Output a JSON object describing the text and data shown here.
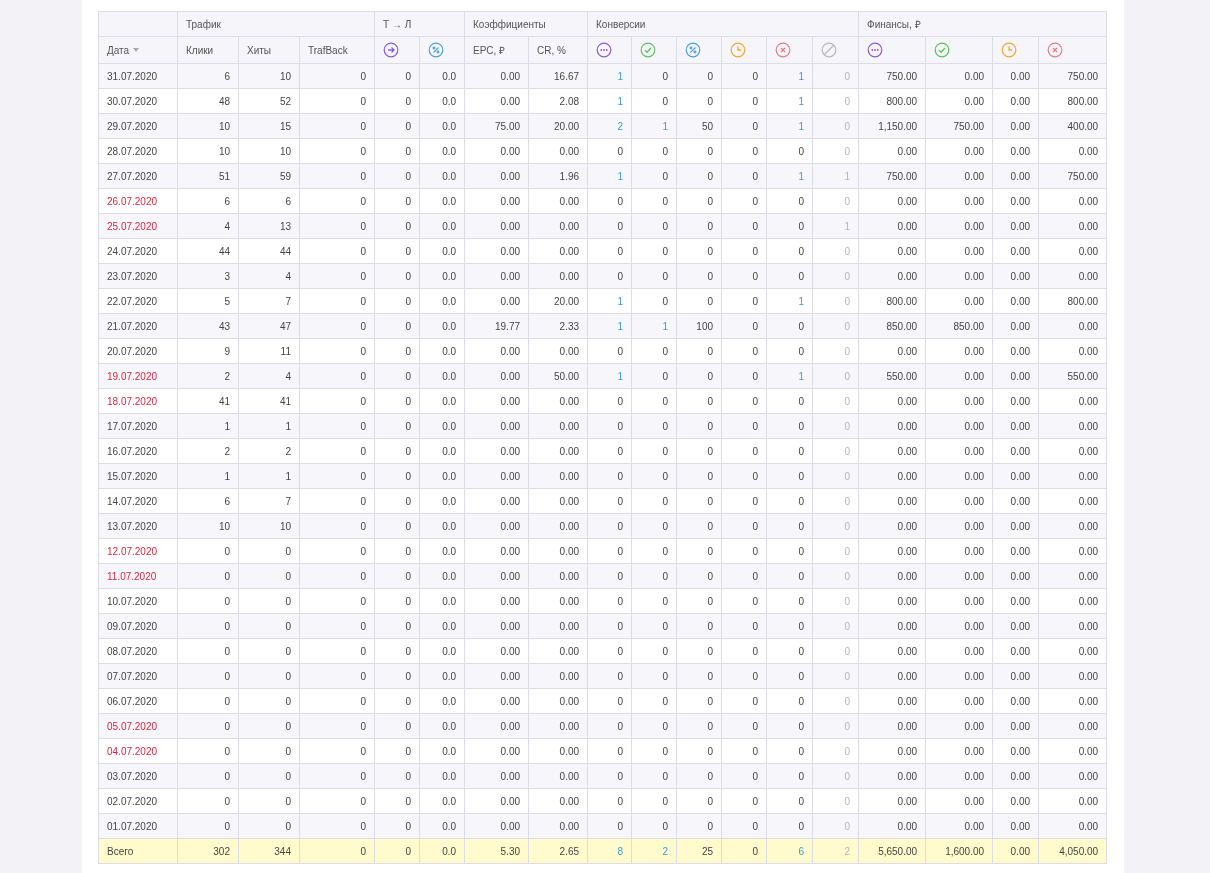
{
  "groups": [
    {
      "label": "Трафик"
    },
    {
      "label": "Т → Л"
    },
    {
      "label": "Коэффициенты"
    },
    {
      "label": "Конверсии"
    },
    {
      "label": "Финансы, ₽"
    }
  ],
  "columns": [
    {
      "kind": "text",
      "label": "Дата",
      "sorted": true
    },
    {
      "kind": "text",
      "label": "Клики"
    },
    {
      "kind": "text",
      "label": "Хиты"
    },
    {
      "kind": "text",
      "label": "TrafBack"
    },
    {
      "kind": "icon"
    },
    {
      "kind": "icon"
    },
    {
      "kind": "text",
      "label": "EPC, ₽"
    },
    {
      "kind": "text",
      "label": "CR, %"
    },
    {
      "kind": "icon"
    },
    {
      "kind": "icon"
    },
    {
      "kind": "icon"
    },
    {
      "kind": "icon"
    },
    {
      "kind": "icon"
    },
    {
      "kind": "icon"
    },
    {
      "kind": "icon"
    },
    {
      "kind": "icon"
    },
    {
      "kind": "icon"
    },
    {
      "kind": "icon"
    }
  ],
  "rows": [
    {
      "date": "31.07.2020",
      "weekend": false,
      "cells": [
        "6",
        "10",
        "0",
        "0",
        "0.0",
        "0.00",
        "16.67",
        {
          "kind": "link",
          "value": "1"
        },
        "0",
        "0",
        "0",
        {
          "kind": "link",
          "value": "1"
        },
        "0",
        "750.00",
        "0.00",
        "0.00",
        "750.00"
      ]
    },
    {
      "date": "30.07.2020",
      "weekend": false,
      "cells": [
        "48",
        "52",
        "0",
        "0",
        "0.0",
        "0.00",
        "2.08",
        {
          "kind": "link",
          "value": "1"
        },
        "0",
        "0",
        "0",
        {
          "kind": "link",
          "value": "1"
        },
        "0",
        "800.00",
        "0.00",
        "0.00",
        "800.00"
      ]
    },
    {
      "date": "29.07.2020",
      "weekend": false,
      "cells": [
        "10",
        "15",
        "0",
        "0",
        "0.0",
        "75.00",
        "20.00",
        {
          "kind": "link",
          "value": "2"
        },
        {
          "kind": "link",
          "value": "1"
        },
        "50",
        "0",
        {
          "kind": "link",
          "value": "1"
        },
        "0",
        "1,150.00",
        "750.00",
        "0.00",
        "400.00"
      ]
    },
    {
      "date": "28.07.2020",
      "weekend": false,
      "cells": [
        "10",
        "10",
        "0",
        "0",
        "0.0",
        "0.00",
        "0.00",
        "0",
        "0",
        "0",
        "0",
        "0",
        "0",
        "0.00",
        "0.00",
        "0.00",
        "0.00"
      ]
    },
    {
      "date": "27.07.2020",
      "weekend": false,
      "cells": [
        "51",
        "59",
        "0",
        "0",
        "0.0",
        "0.00",
        "1.96",
        {
          "kind": "link",
          "value": "1"
        },
        "0",
        "0",
        "0",
        {
          "kind": "link",
          "value": "1"
        },
        "1",
        "750.00",
        "0.00",
        "0.00",
        "750.00"
      ]
    },
    {
      "date": "26.07.2020",
      "weekend": true,
      "cells": [
        "6",
        "6",
        "0",
        "0",
        "0.0",
        "0.00",
        "0.00",
        "0",
        "0",
        "0",
        "0",
        "0",
        "0",
        "0.00",
        "0.00",
        "0.00",
        "0.00"
      ]
    },
    {
      "date": "25.07.2020",
      "weekend": true,
      "cells": [
        "4",
        "13",
        "0",
        "0",
        "0.0",
        "0.00",
        "0.00",
        "0",
        "0",
        "0",
        "0",
        "0",
        "1",
        "0.00",
        "0.00",
        "0.00",
        "0.00"
      ]
    },
    {
      "date": "24.07.2020",
      "weekend": false,
      "cells": [
        "44",
        "44",
        "0",
        "0",
        "0.0",
        "0.00",
        "0.00",
        "0",
        "0",
        "0",
        "0",
        "0",
        "0",
        "0.00",
        "0.00",
        "0.00",
        "0.00"
      ]
    },
    {
      "date": "23.07.2020",
      "weekend": false,
      "cells": [
        "3",
        "4",
        "0",
        "0",
        "0.0",
        "0.00",
        "0.00",
        "0",
        "0",
        "0",
        "0",
        "0",
        "0",
        "0.00",
        "0.00",
        "0.00",
        "0.00"
      ]
    },
    {
      "date": "22.07.2020",
      "weekend": false,
      "cells": [
        "5",
        "7",
        "0",
        "0",
        "0.0",
        "0.00",
        "20.00",
        {
          "kind": "link",
          "value": "1"
        },
        "0",
        "0",
        "0",
        {
          "kind": "link",
          "value": "1"
        },
        "0",
        "800.00",
        "0.00",
        "0.00",
        "800.00"
      ]
    },
    {
      "date": "21.07.2020",
      "weekend": false,
      "cells": [
        "43",
        "47",
        "0",
        "0",
        "0.0",
        "19.77",
        "2.33",
        {
          "kind": "link",
          "value": "1"
        },
        {
          "kind": "link",
          "value": "1"
        },
        "100",
        "0",
        "0",
        "0",
        "850.00",
        "850.00",
        "0.00",
        "0.00"
      ]
    },
    {
      "date": "20.07.2020",
      "weekend": false,
      "cells": [
        "9",
        "11",
        "0",
        "0",
        "0.0",
        "0.00",
        "0.00",
        "0",
        "0",
        "0",
        "0",
        "0",
        "0",
        "0.00",
        "0.00",
        "0.00",
        "0.00"
      ]
    },
    {
      "date": "19.07.2020",
      "weekend": true,
      "cells": [
        "2",
        "4",
        "0",
        "0",
        "0.0",
        "0.00",
        "50.00",
        {
          "kind": "link",
          "value": "1"
        },
        "0",
        "0",
        "0",
        {
          "kind": "link",
          "value": "1"
        },
        "0",
        "550.00",
        "0.00",
        "0.00",
        "550.00"
      ]
    },
    {
      "date": "18.07.2020",
      "weekend": true,
      "cells": [
        "41",
        "41",
        "0",
        "0",
        "0.0",
        "0.00",
        "0.00",
        "0",
        "0",
        "0",
        "0",
        "0",
        "0",
        "0.00",
        "0.00",
        "0.00",
        "0.00"
      ]
    },
    {
      "date": "17.07.2020",
      "weekend": false,
      "cells": [
        "1",
        "1",
        "0",
        "0",
        "0.0",
        "0.00",
        "0.00",
        "0",
        "0",
        "0",
        "0",
        "0",
        "0",
        "0.00",
        "0.00",
        "0.00",
        "0.00"
      ]
    },
    {
      "date": "16.07.2020",
      "weekend": false,
      "cells": [
        "2",
        "2",
        "0",
        "0",
        "0.0",
        "0.00",
        "0.00",
        "0",
        "0",
        "0",
        "0",
        "0",
        "0",
        "0.00",
        "0.00",
        "0.00",
        "0.00"
      ]
    },
    {
      "date": "15.07.2020",
      "weekend": false,
      "cells": [
        "1",
        "1",
        "0",
        "0",
        "0.0",
        "0.00",
        "0.00",
        "0",
        "0",
        "0",
        "0",
        "0",
        "0",
        "0.00",
        "0.00",
        "0.00",
        "0.00"
      ]
    },
    {
      "date": "14.07.2020",
      "weekend": false,
      "cells": [
        "6",
        "7",
        "0",
        "0",
        "0.0",
        "0.00",
        "0.00",
        "0",
        "0",
        "0",
        "0",
        "0",
        "0",
        "0.00",
        "0.00",
        "0.00",
        "0.00"
      ]
    },
    {
      "date": "13.07.2020",
      "weekend": false,
      "cells": [
        "10",
        "10",
        "0",
        "0",
        "0.0",
        "0.00",
        "0.00",
        "0",
        "0",
        "0",
        "0",
        "0",
        "0",
        "0.00",
        "0.00",
        "0.00",
        "0.00"
      ]
    },
    {
      "date": "12.07.2020",
      "weekend": true,
      "cells": [
        "0",
        "0",
        "0",
        "0",
        "0.0",
        "0.00",
        "0.00",
        "0",
        "0",
        "0",
        "0",
        "0",
        "0",
        "0.00",
        "0.00",
        "0.00",
        "0.00"
      ]
    },
    {
      "date": "11.07.2020",
      "weekend": true,
      "cells": [
        "0",
        "0",
        "0",
        "0",
        "0.0",
        "0.00",
        "0.00",
        "0",
        "0",
        "0",
        "0",
        "0",
        "0",
        "0.00",
        "0.00",
        "0.00",
        "0.00"
      ]
    },
    {
      "date": "10.07.2020",
      "weekend": false,
      "cells": [
        "0",
        "0",
        "0",
        "0",
        "0.0",
        "0.00",
        "0.00",
        "0",
        "0",
        "0",
        "0",
        "0",
        "0",
        "0.00",
        "0.00",
        "0.00",
        "0.00"
      ]
    },
    {
      "date": "09.07.2020",
      "weekend": false,
      "cells": [
        "0",
        "0",
        "0",
        "0",
        "0.0",
        "0.00",
        "0.00",
        "0",
        "0",
        "0",
        "0",
        "0",
        "0",
        "0.00",
        "0.00",
        "0.00",
        "0.00"
      ]
    },
    {
      "date": "08.07.2020",
      "weekend": false,
      "cells": [
        "0",
        "0",
        "0",
        "0",
        "0.0",
        "0.00",
        "0.00",
        "0",
        "0",
        "0",
        "0",
        "0",
        "0",
        "0.00",
        "0.00",
        "0.00",
        "0.00"
      ]
    },
    {
      "date": "07.07.2020",
      "weekend": false,
      "cells": [
        "0",
        "0",
        "0",
        "0",
        "0.0",
        "0.00",
        "0.00",
        "0",
        "0",
        "0",
        "0",
        "0",
        "0",
        "0.00",
        "0.00",
        "0.00",
        "0.00"
      ]
    },
    {
      "date": "06.07.2020",
      "weekend": false,
      "cells": [
        "0",
        "0",
        "0",
        "0",
        "0.0",
        "0.00",
        "0.00",
        "0",
        "0",
        "0",
        "0",
        "0",
        "0",
        "0.00",
        "0.00",
        "0.00",
        "0.00"
      ]
    },
    {
      "date": "05.07.2020",
      "weekend": true,
      "cells": [
        "0",
        "0",
        "0",
        "0",
        "0.0",
        "0.00",
        "0.00",
        "0",
        "0",
        "0",
        "0",
        "0",
        "0",
        "0.00",
        "0.00",
        "0.00",
        "0.00"
      ]
    },
    {
      "date": "04.07.2020",
      "weekend": true,
      "cells": [
        "0",
        "0",
        "0",
        "0",
        "0.0",
        "0.00",
        "0.00",
        "0",
        "0",
        "0",
        "0",
        "0",
        "0",
        "0.00",
        "0.00",
        "0.00",
        "0.00"
      ]
    },
    {
      "date": "03.07.2020",
      "weekend": false,
      "cells": [
        "0",
        "0",
        "0",
        "0",
        "0.0",
        "0.00",
        "0.00",
        "0",
        "0",
        "0",
        "0",
        "0",
        "0",
        "0.00",
        "0.00",
        "0.00",
        "0.00"
      ]
    },
    {
      "date": "02.07.2020",
      "weekend": false,
      "cells": [
        "0",
        "0",
        "0",
        "0",
        "0.0",
        "0.00",
        "0.00",
        "0",
        "0",
        "0",
        "0",
        "0",
        "0",
        "0.00",
        "0.00",
        "0.00",
        "0.00"
      ]
    },
    {
      "date": "01.07.2020",
      "weekend": false,
      "cells": [
        "0",
        "0",
        "0",
        "0",
        "0.0",
        "0.00",
        "0.00",
        "0",
        "0",
        "0",
        "0",
        "0",
        "0",
        "0.00",
        "0.00",
        "0.00",
        "0.00"
      ]
    }
  ],
  "total": {
    "label": "Всего",
    "cells": [
      "302",
      "344",
      "0",
      "0",
      "0.0",
      "5.30",
      "2.65",
      {
        "kind": "link",
        "value": "8"
      },
      {
        "kind": "link",
        "value": "2"
      },
      "25",
      "0",
      {
        "kind": "link",
        "value": "6"
      },
      "2",
      "5,650.00",
      "1,600.00",
      "0.00",
      "4,050.00"
    ]
  }
}
